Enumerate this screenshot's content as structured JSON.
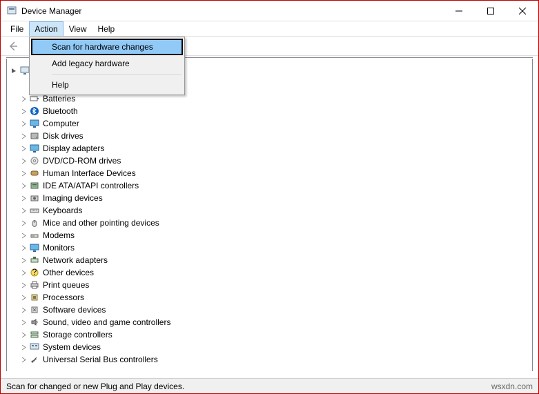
{
  "window": {
    "title": "Device Manager"
  },
  "menubar": {
    "file": "File",
    "action": "Action",
    "view": "View",
    "help": "Help"
  },
  "dropdown": {
    "scan": "Scan for hardware changes",
    "legacy": "Add legacy hardware",
    "help": "Help"
  },
  "tree": {
    "root_fragment": "Batteries",
    "items": [
      {
        "label": "Bluetooth",
        "icon": "bluetooth"
      },
      {
        "label": "Computer",
        "icon": "monitor"
      },
      {
        "label": "Disk drives",
        "icon": "disk"
      },
      {
        "label": "Display adapters",
        "icon": "monitor"
      },
      {
        "label": "DVD/CD-ROM drives",
        "icon": "cd"
      },
      {
        "label": "Human Interface Devices",
        "icon": "hid"
      },
      {
        "label": "IDE ATA/ATAPI controllers",
        "icon": "ide"
      },
      {
        "label": "Imaging devices",
        "icon": "camera"
      },
      {
        "label": "Keyboards",
        "icon": "keyboard"
      },
      {
        "label": "Mice and other pointing devices",
        "icon": "mouse"
      },
      {
        "label": "Modems",
        "icon": "modem"
      },
      {
        "label": "Monitors",
        "icon": "monitor"
      },
      {
        "label": "Network adapters",
        "icon": "network"
      },
      {
        "label": "Other devices",
        "icon": "other"
      },
      {
        "label": "Print queues",
        "icon": "printer"
      },
      {
        "label": "Processors",
        "icon": "cpu"
      },
      {
        "label": "Software devices",
        "icon": "software"
      },
      {
        "label": "Sound, video and game controllers",
        "icon": "sound"
      },
      {
        "label": "Storage controllers",
        "icon": "storage"
      },
      {
        "label": "System devices",
        "icon": "system"
      },
      {
        "label": "Universal Serial Bus controllers",
        "icon": "usb"
      }
    ]
  },
  "statusbar": {
    "left": "Scan for changed or new Plug and Play devices.",
    "right": "wsxdn.com"
  }
}
